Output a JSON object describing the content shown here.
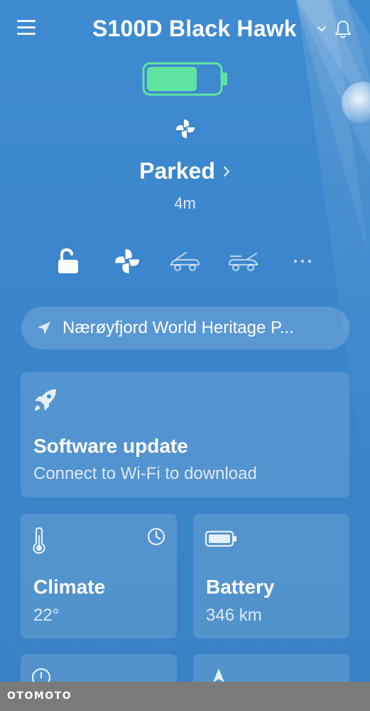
{
  "header": {
    "title": "S100D Black Hawk",
    "menu_icon": "hamburger-menu-icon",
    "dropdown_icon": "chevron-down-icon",
    "notification_icon": "bell-icon"
  },
  "battery": {
    "icon": "battery-icon",
    "level_fraction": 0.7,
    "fill_color": "#5fe3a1"
  },
  "climate_indicator_icon": "fan-icon",
  "status": {
    "label": "Parked",
    "duration": "4m"
  },
  "controls": [
    {
      "name": "unlock-icon",
      "active": true
    },
    {
      "name": "fan-icon",
      "active": true
    },
    {
      "name": "frunk-icon",
      "active": false
    },
    {
      "name": "trunk-icon",
      "active": false
    },
    {
      "name": "more-icon",
      "active": false
    }
  ],
  "location": {
    "text": "Nærøyfjord World Heritage P...",
    "icon": "navigation-arrow-icon"
  },
  "software_card": {
    "icon": "rocket-icon",
    "title": "Software update",
    "subtitle": "Connect to Wi-Fi to download"
  },
  "climate_card": {
    "icon": "thermometer-icon",
    "action_icon": "clock-icon",
    "title": "Climate",
    "value": "22°"
  },
  "battery_card": {
    "icon": "battery-icon",
    "title": "Battery",
    "value": "346 km"
  },
  "footer": {
    "watermark": "OTOMOTO"
  }
}
